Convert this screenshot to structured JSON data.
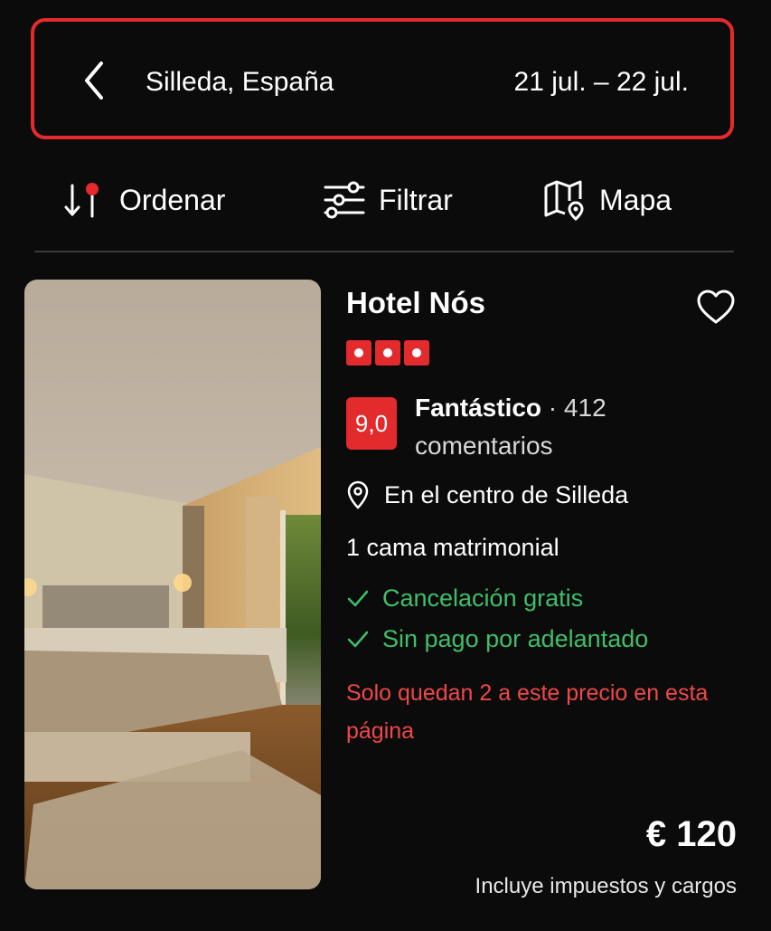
{
  "search": {
    "location": "Silleda, España",
    "dates": "21 jul. – 22 jul."
  },
  "toolbar": {
    "sort_label": "Ordenar",
    "filter_label": "Filtrar",
    "map_label": "Mapa"
  },
  "hotel": {
    "name": "Hotel Nós",
    "star_count": 3,
    "score": "9,0",
    "rating_word": "Fantástico",
    "review_count": "412",
    "reviews_label": "comentarios",
    "location": "En el centro de Silleda",
    "bed": "1 cama matrimonial",
    "perk_1": "Cancelación gratis",
    "perk_2": "Sin pago por adelantado",
    "scarcity": "Solo quedan 2 a este precio en esta página",
    "price": "€ 120",
    "price_note": "Incluye impuestos y cargos"
  },
  "colors": {
    "accent": "#e32a2c",
    "positive": "#3fbf6a",
    "warning": "#ee4848",
    "background": "#0b0b0b"
  },
  "icons": [
    "chevron-left-icon",
    "sort-icon",
    "filter-sliders-icon",
    "map-icon",
    "heart-icon",
    "location-pin-icon",
    "check-icon"
  ]
}
